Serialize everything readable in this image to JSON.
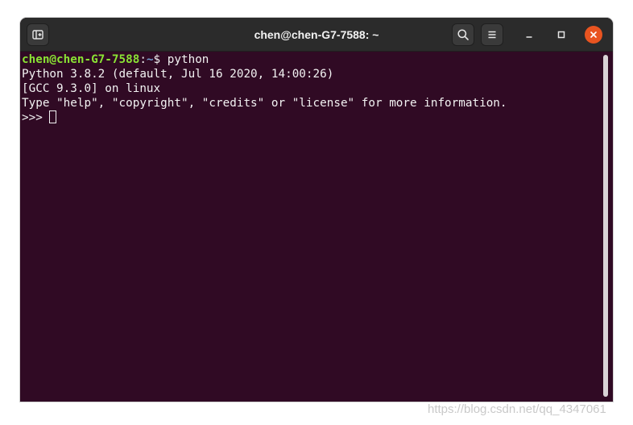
{
  "window": {
    "title": "chen@chen-G7-7588: ~"
  },
  "titlebar": {
    "new_tab_icon": "new-tab-icon",
    "search_icon": "search-icon",
    "menu_icon": "hamburger-menu-icon",
    "minimize_icon": "minimize-icon",
    "maximize_icon": "maximize-icon",
    "close_icon": "close-icon",
    "close_color": "#e95420"
  },
  "terminal": {
    "background": "#300a24",
    "prompt": {
      "user_host": "chen@chen-G7-7588",
      "separator": ":",
      "path": "~",
      "symbol": "$ ",
      "command": "python"
    },
    "output": [
      "Python 3.8.2 (default, Jul 16 2020, 14:00:26)",
      "[GCC 9.3.0] on linux",
      "Type \"help\", \"copyright\", \"credits\" or \"license\" for more information."
    ],
    "repl_prompt": ">>> "
  },
  "watermark": "https://blog.csdn.net/qq_4347061"
}
